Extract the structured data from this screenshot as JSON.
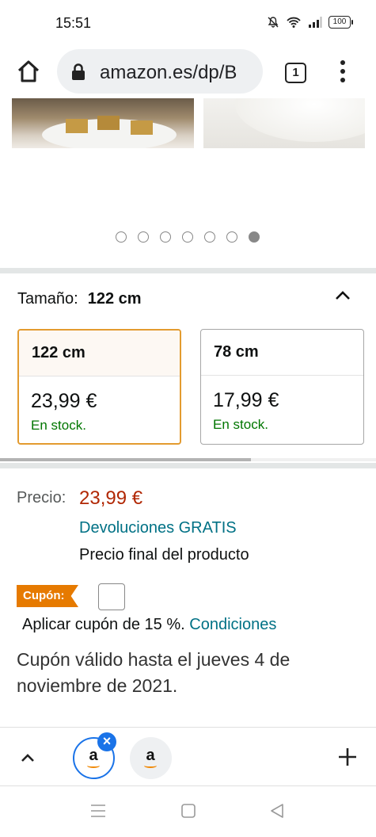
{
  "status_bar": {
    "time": "15:51",
    "battery": "100"
  },
  "browser": {
    "url": "amazon.es/dp/B",
    "tab_count": "1"
  },
  "gallery": {
    "dot_count": 7,
    "active_dot": 6
  },
  "size_selector": {
    "label": "Tamaño:",
    "selected": "122 cm",
    "options": [
      {
        "size": "122 cm",
        "price": "23,99 €",
        "stock": "En stock.",
        "selected": true
      },
      {
        "size": "78 cm",
        "price": "17,99 €",
        "stock": "En stock.",
        "selected": false
      }
    ]
  },
  "price_block": {
    "label": "Precio:",
    "price": "23,99 €",
    "returns": "Devoluciones GRATIS",
    "final_price": "Precio final del producto"
  },
  "coupon": {
    "badge": "Cupón:",
    "apply_text": "Aplicar cupón de 15 %.",
    "conditions_link": "Condiciones",
    "validity": "Cupón válido hasta el jueves 4 de noviembre de 2021."
  },
  "tab_strip": {
    "tab_letter": "a"
  },
  "colors": {
    "accent": "#e67a00",
    "price": "#b12704",
    "link": "#007185",
    "stock": "#007600",
    "selection": "#1a73e8"
  }
}
